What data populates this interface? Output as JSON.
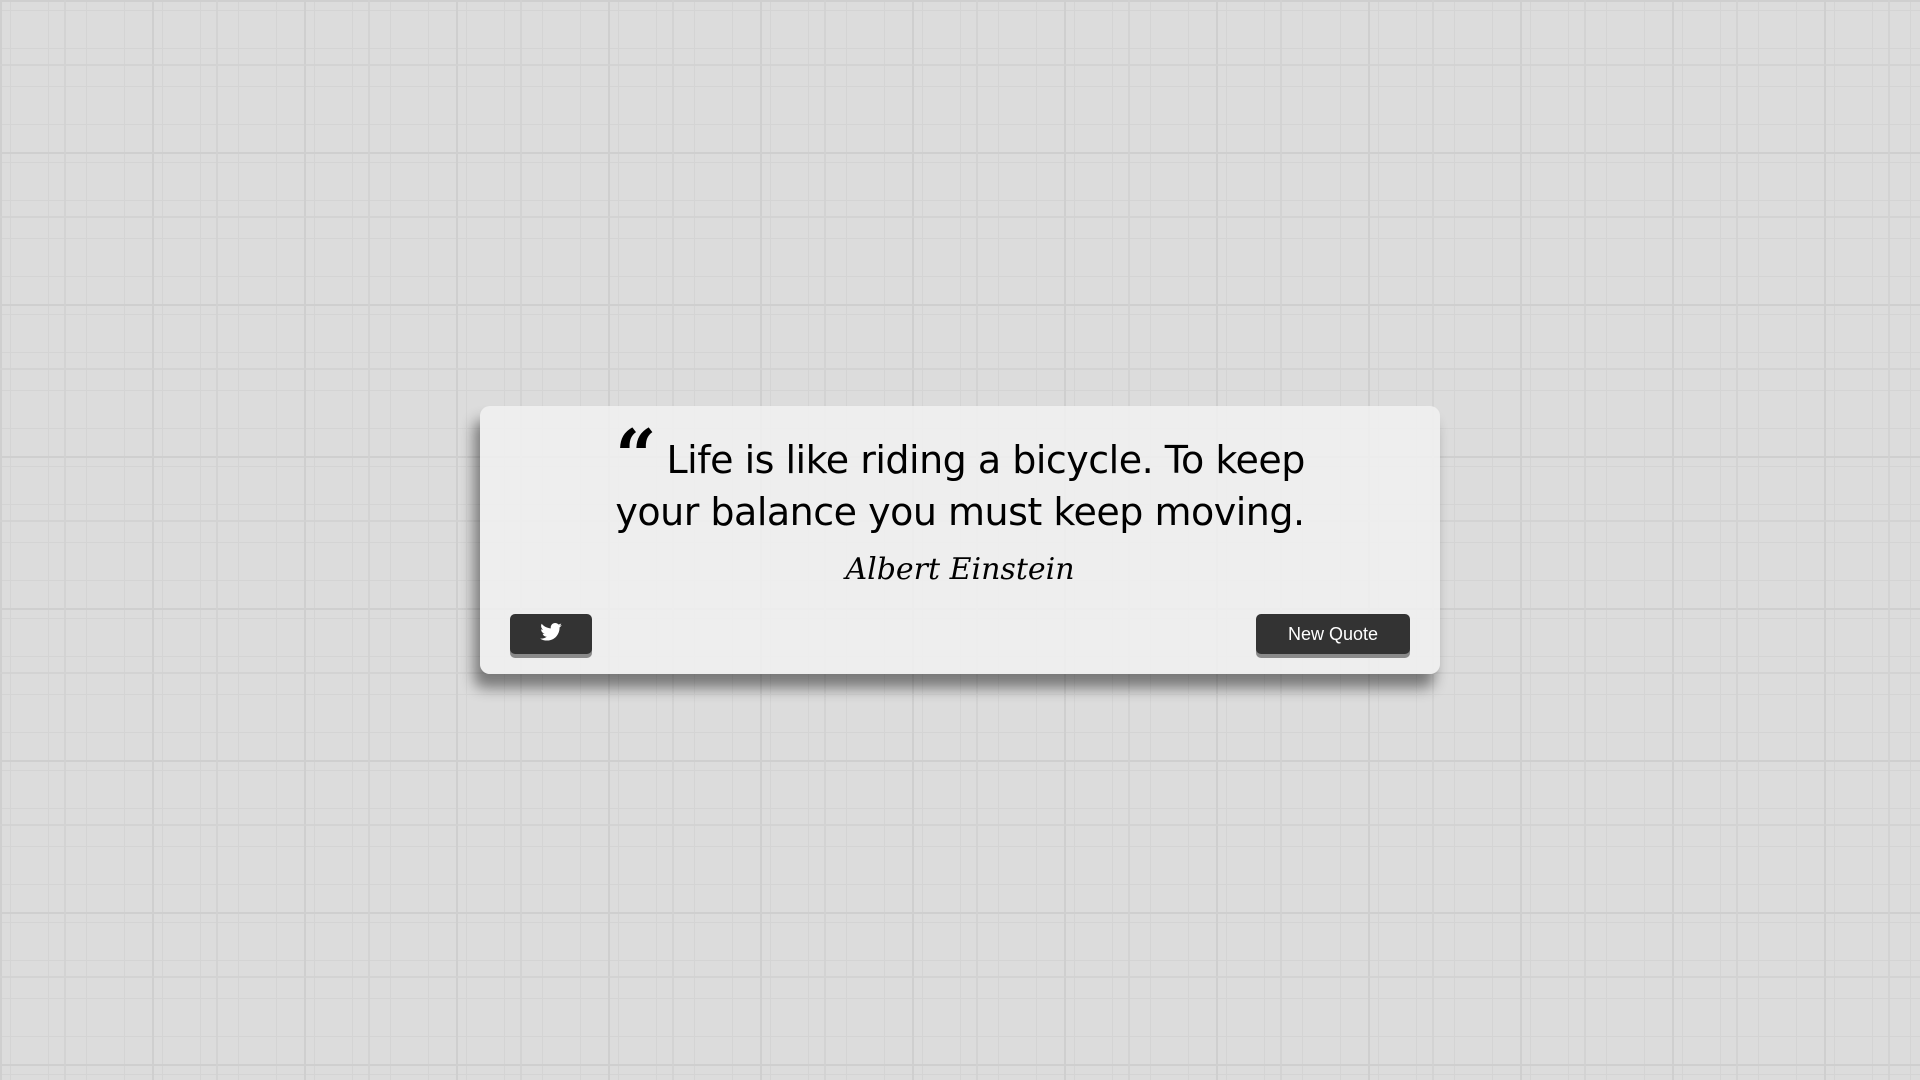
{
  "quote": {
    "mark": "“",
    "text": "Life is like riding a bicycle. To keep your balance you must keep moving.",
    "author": "Albert Einstein"
  },
  "buttons": {
    "tweet_icon": "twitter-icon",
    "new_quote_label": "New Quote"
  },
  "colors": {
    "button_bg": "#333333",
    "button_text": "#ffffff",
    "card_bg": "#f0f0f0"
  }
}
